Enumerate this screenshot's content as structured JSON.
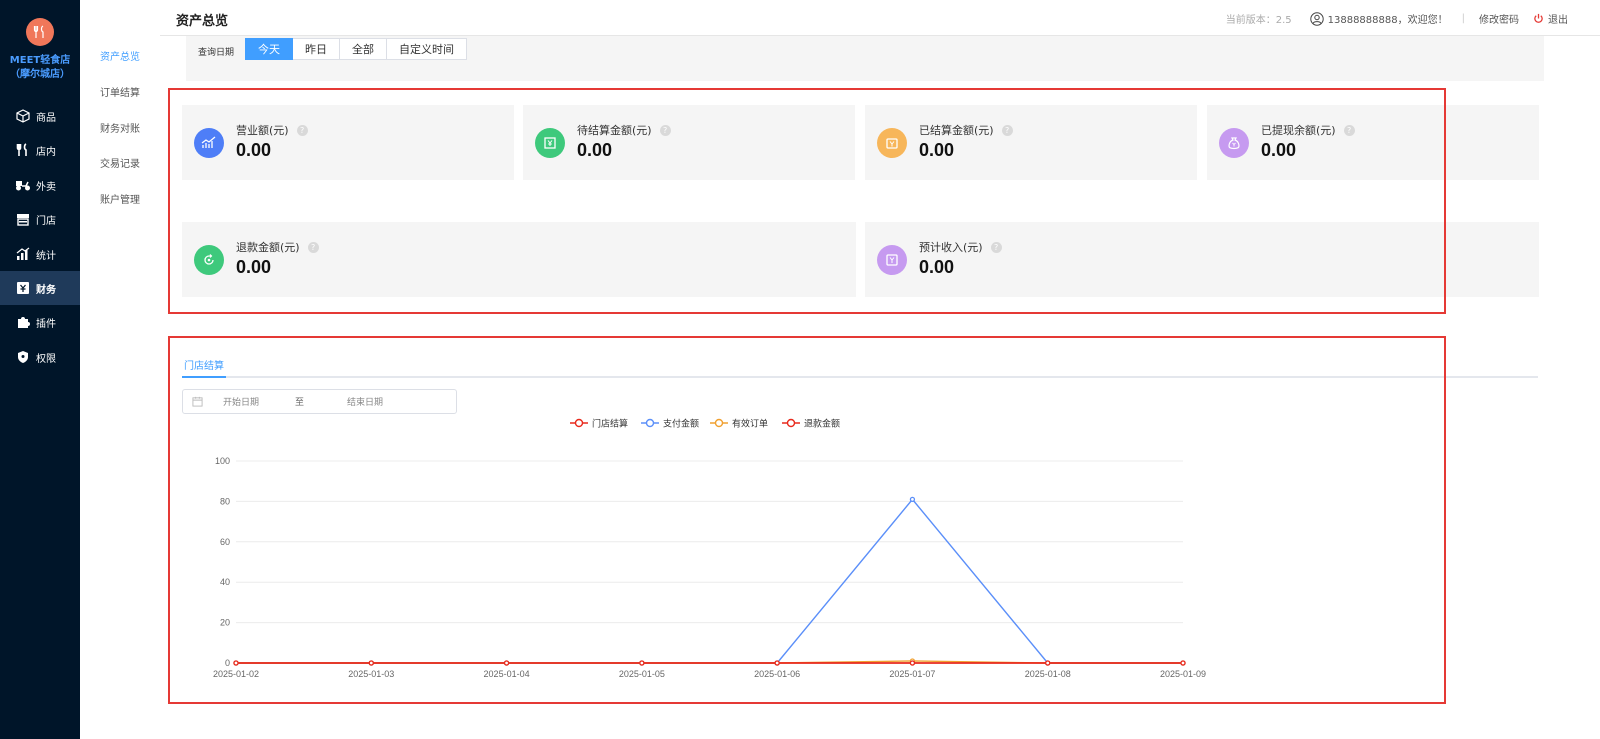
{
  "store": {
    "name": "MEET轻食店（摩尔城店）"
  },
  "nav": {
    "items": [
      {
        "label": "商品",
        "icon": "box-icon"
      },
      {
        "label": "店内",
        "icon": "utensils-icon"
      },
      {
        "label": "外卖",
        "icon": "scooter-icon"
      },
      {
        "label": "门店",
        "icon": "storefront-icon"
      },
      {
        "label": "统计",
        "icon": "chart-icon"
      },
      {
        "label": "财务",
        "icon": "finance-icon",
        "active": true
      },
      {
        "label": "插件",
        "icon": "puzzle-icon"
      },
      {
        "label": "权限",
        "icon": "shield-icon"
      }
    ]
  },
  "subnav": {
    "items": [
      "资产总览",
      "订单结算",
      "财务对账",
      "交易记录",
      "账户管理"
    ],
    "active": "资产总览"
  },
  "header": {
    "title": "资产总览",
    "version": "当前版本：2.5",
    "user_greeting": "13888888888，欢迎您！",
    "separator": "|",
    "change_password": "修改密码",
    "logout": "退出"
  },
  "filter": {
    "label": "查询日期",
    "tabs": [
      "今天",
      "昨日",
      "全部",
      "自定义时间"
    ],
    "active": "今天"
  },
  "cards": [
    {
      "label": "营业额(元)",
      "value": "0.00",
      "color": "#4e7ef7",
      "icon": "trend-chart-icon"
    },
    {
      "label": "待结算金额(元)",
      "value": "0.00",
      "color": "#3ec97c",
      "icon": "pending-money-icon"
    },
    {
      "label": "已结算金额(元)",
      "value": "0.00",
      "color": "#f7b65a",
      "icon": "settled-wallet-icon"
    },
    {
      "label": "已提现余额(元)",
      "value": "0.00",
      "color": "#c69af0",
      "icon": "money-bag-icon"
    },
    {
      "label": "退款金额(元)",
      "value": "0.00",
      "color": "#3ec97c",
      "icon": "refund-icon"
    },
    {
      "label": "预计收入(元)",
      "value": "0.00",
      "color": "#c69af0",
      "icon": "income-icon"
    }
  ],
  "tab": {
    "label": "门店结算"
  },
  "date_range": {
    "start_placeholder": "开始日期",
    "separator": "至",
    "end_placeholder": "结束日期"
  },
  "colors": {
    "accent": "#409eff",
    "nav_bg": "#001529",
    "highlight": "#e53935"
  },
  "chart_data": {
    "type": "line",
    "x": [
      "2025-01-02",
      "2025-01-03",
      "2025-01-04",
      "2025-01-05",
      "2025-01-06",
      "2025-01-07",
      "2025-01-08",
      "2025-01-09"
    ],
    "ylim": [
      0,
      100
    ],
    "yticks": [
      0,
      20,
      40,
      60,
      80,
      100
    ],
    "grid": true,
    "legend_position": "top",
    "series": [
      {
        "name": "门店结算",
        "color": "#e8291c",
        "values": [
          0,
          0,
          0,
          0,
          0,
          0,
          0,
          0
        ]
      },
      {
        "name": "支付金额",
        "color": "#5b8ff9",
        "values": [
          0,
          0,
          0,
          0,
          0,
          81,
          0,
          0
        ]
      },
      {
        "name": "有效订单",
        "color": "#f0a030",
        "values": [
          0,
          0,
          0,
          0,
          0,
          1,
          0,
          0
        ]
      },
      {
        "name": "退款金额",
        "color": "#e8291c",
        "values": [
          0,
          0,
          0,
          0,
          0,
          0,
          0,
          0
        ]
      }
    ]
  }
}
